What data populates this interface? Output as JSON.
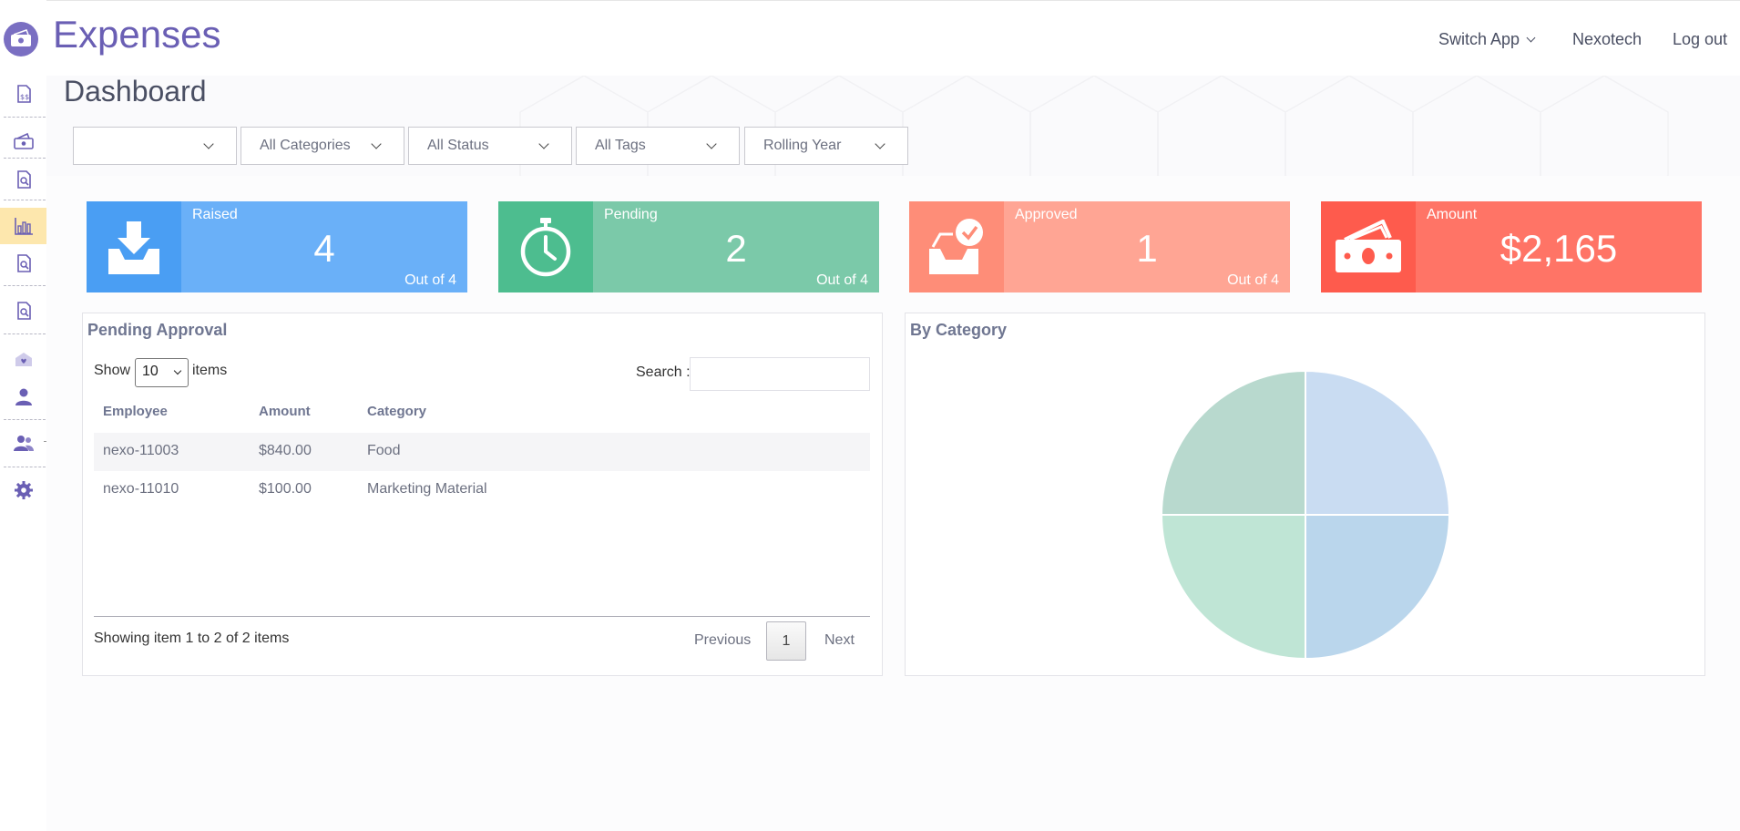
{
  "app": {
    "title": "Expenses"
  },
  "topnav": {
    "switch_app": "Switch App",
    "company": "Nexotech",
    "logout": "Log out"
  },
  "sidebar": {
    "items": [
      {
        "name": "expense-report-icon",
        "active": false
      },
      {
        "name": "cash-icon",
        "active": false
      },
      {
        "name": "review-icon",
        "active": false
      },
      {
        "name": "dashboard-chart-icon",
        "active": true
      },
      {
        "name": "report-search-icon",
        "active": false
      },
      {
        "name": "document-search-icon",
        "active": false
      },
      {
        "name": "favorites-icon",
        "active": false
      },
      {
        "name": "user-icon",
        "active": false
      },
      {
        "name": "users-icon",
        "active": false
      },
      {
        "name": "gear-icon",
        "active": false
      }
    ]
  },
  "page": {
    "title": "Dashboard"
  },
  "filters": {
    "employee": "",
    "category": "All Categories",
    "status": "All Status",
    "tags": "All Tags",
    "period": "Rolling Year"
  },
  "cards": {
    "raised": {
      "label": "Raised",
      "value": "4",
      "sub": "Out of 4",
      "color": "#6ab0f8",
      "icon_color": "#4a9ef3"
    },
    "pending": {
      "label": "Pending",
      "value": "2",
      "sub": "Out of 4",
      "color": "#7bc9a9",
      "icon_color": "#4dbd8f"
    },
    "approved": {
      "label": "Approved",
      "value": "1",
      "sub": "Out of 4",
      "color": "#ffa594",
      "icon_color": "#fe8d78"
    },
    "amount": {
      "label": "Amount",
      "value": "$2,165",
      "color": "#ff7466",
      "icon_color": "#fe5b4d"
    }
  },
  "pending_approval": {
    "title": "Pending Approval",
    "show_label": "Show",
    "page_size": "10",
    "items_label": "items",
    "search_label": "Search :",
    "search_value": "",
    "columns": [
      "Employee",
      "Amount",
      "Category"
    ],
    "rows": [
      [
        "nexo-11003",
        "$840.00",
        "Food"
      ],
      [
        "nexo-11010",
        "$100.00",
        "Marketing Material"
      ]
    ],
    "showing": "Showing item 1 to 2 of 2 items",
    "prev": "Previous",
    "current_page": "1",
    "next": "Next"
  },
  "by_category": {
    "title": "By Category"
  },
  "chart_data": {
    "type": "pie",
    "title": "",
    "slices": [
      {
        "value": 25,
        "color": "#c9dcf2"
      },
      {
        "value": 25,
        "color": "#bad6ec"
      },
      {
        "value": 25,
        "color": "#bfe5d5"
      },
      {
        "value": 25,
        "color": "#b8d9ce"
      }
    ]
  }
}
